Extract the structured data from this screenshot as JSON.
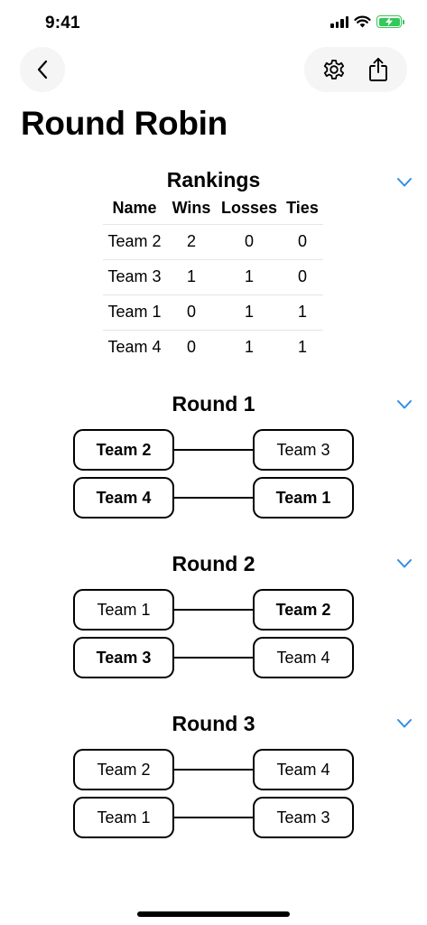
{
  "status": {
    "time": "9:41"
  },
  "header": {
    "title": "Round Robin"
  },
  "colors": {
    "accent": "#2f8de4",
    "battery": "#34c759"
  },
  "icons": {
    "back": "chevron-left-icon",
    "settings": "gear-icon",
    "share": "share-icon",
    "collapse": "chevron-down-icon"
  },
  "rankings": {
    "title": "Rankings",
    "columns": [
      "Name",
      "Wins",
      "Losses",
      "Ties"
    ],
    "rows": [
      [
        "Team 2",
        "2",
        "0",
        "0"
      ],
      [
        "Team 3",
        "1",
        "1",
        "0"
      ],
      [
        "Team 1",
        "0",
        "1",
        "1"
      ],
      [
        "Team 4",
        "0",
        "1",
        "1"
      ]
    ]
  },
  "rounds": [
    {
      "title": "Round 1",
      "matches": [
        {
          "left": "Team 2",
          "right": "Team 3",
          "winner": "left"
        },
        {
          "left": "Team 4",
          "right": "Team 1",
          "winner": "both"
        }
      ]
    },
    {
      "title": "Round 2",
      "matches": [
        {
          "left": "Team 1",
          "right": "Team 2",
          "winner": "right"
        },
        {
          "left": "Team 3",
          "right": "Team 4",
          "winner": "left"
        }
      ]
    },
    {
      "title": "Round 3",
      "matches": [
        {
          "left": "Team 2",
          "right": "Team 4",
          "winner": "none"
        },
        {
          "left": "Team 1",
          "right": "Team 3",
          "winner": "none"
        }
      ]
    }
  ]
}
